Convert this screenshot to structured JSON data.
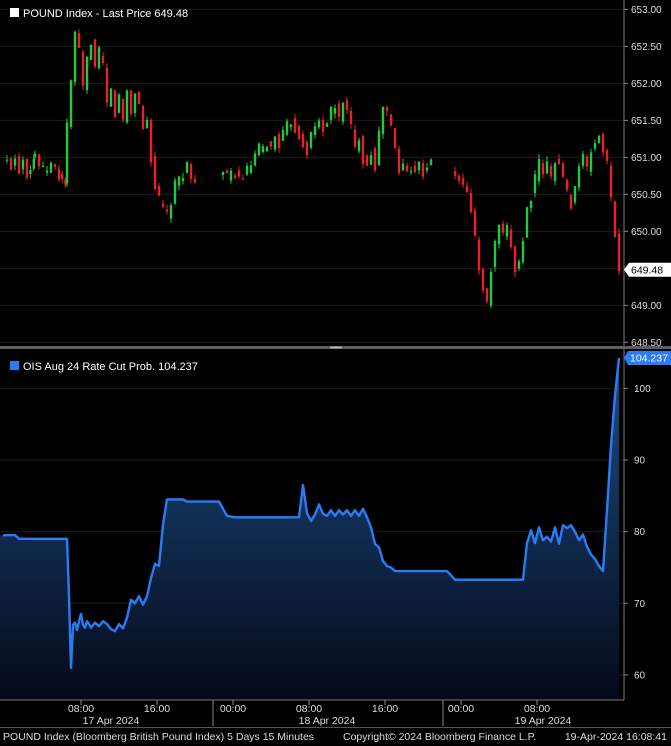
{
  "chart_data": [
    {
      "type": "candlestick",
      "legend": "POUND Index - Last Price 649.48",
      "last_value_label": "649.48",
      "ylim": [
        648.45,
        653.1
      ],
      "yticks": [
        648.5,
        649.0,
        649.5,
        650.0,
        650.5,
        651.0,
        651.5,
        652.0,
        652.5,
        653.0
      ],
      "ytick_labels": [
        "648.50",
        "649.00",
        "649.50",
        "650.00",
        "650.50",
        "651.00",
        "651.50",
        "652.00",
        "652.50",
        "653.00"
      ],
      "up_color": "#22c93a",
      "down_color": "#e8202a",
      "path": [
        [
          0,
          650.95
        ],
        [
          2,
          650.9
        ],
        [
          3,
          651.0
        ],
        [
          4,
          650.85
        ],
        [
          5,
          651.0
        ],
        [
          6,
          650.8
        ],
        [
          7.7,
          651.0
        ],
        [
          8,
          651.05
        ],
        [
          9,
          650.9
        ],
        [
          10,
          650.8
        ],
        [
          12,
          650.9
        ],
        [
          14,
          650.75
        ],
        [
          15.6,
          650.65
        ],
        [
          16,
          651.4
        ],
        [
          17,
          652.0
        ],
        [
          18,
          652.7
        ],
        [
          19,
          652.4
        ],
        [
          20,
          651.9
        ],
        [
          21,
          652.3
        ],
        [
          22,
          652.6
        ],
        [
          23,
          652.2
        ],
        [
          24,
          652.4
        ],
        [
          25,
          652.2
        ],
        [
          26,
          651.7
        ],
        [
          27,
          651.9
        ],
        [
          28,
          651.6
        ],
        [
          29,
          651.8
        ],
        [
          30,
          651.5
        ],
        [
          31,
          651.9
        ],
        [
          32,
          651.6
        ],
        [
          33,
          651.9
        ],
        [
          34,
          651.7
        ],
        [
          35,
          651.4
        ],
        [
          36,
          651.5
        ],
        [
          37,
          651.0
        ],
        [
          38,
          650.6
        ],
        [
          39,
          650.4
        ],
        [
          40,
          650.3
        ],
        [
          41,
          650.2
        ],
        [
          42,
          650.4
        ],
        [
          43,
          650.6
        ],
        [
          44,
          650.7
        ],
        [
          45,
          650.8
        ],
        [
          46,
          650.9
        ],
        [
          47,
          650.7
        ],
        [
          48,
          650.75
        ],
        [
          54,
          650.75
        ],
        [
          55,
          650.8
        ],
        [
          56,
          650.7
        ],
        [
          57,
          650.75
        ],
        [
          58,
          650.8
        ],
        [
          59,
          650.7
        ],
        [
          60,
          650.75
        ],
        [
          61,
          650.8
        ],
        [
          62,
          650.9
        ],
        [
          63,
          651.0
        ],
        [
          64,
          651.1
        ],
        [
          65,
          651.1
        ],
        [
          66,
          651.2
        ],
        [
          67,
          651.1
        ],
        [
          68,
          651.3
        ],
        [
          69,
          651.2
        ],
        [
          70,
          651.3
        ],
        [
          71,
          651.4
        ],
        [
          72,
          651.5
        ],
        [
          73,
          651.4
        ],
        [
          74,
          651.3
        ],
        [
          75,
          651.2
        ],
        [
          76,
          651.1
        ],
        [
          77,
          651.3
        ],
        [
          78,
          651.4
        ],
        [
          79,
          651.5
        ],
        [
          80,
          651.4
        ],
        [
          81,
          651.5
        ],
        [
          82,
          651.6
        ],
        [
          83,
          651.7
        ],
        [
          84,
          651.5
        ],
        [
          85,
          651.8
        ],
        [
          86,
          651.6
        ],
        [
          87,
          651.4
        ],
        [
          88,
          651.1
        ],
        [
          89,
          651.3
        ],
        [
          90,
          651.0
        ],
        [
          91,
          650.9
        ],
        [
          92,
          651.1
        ],
        [
          93,
          650.9
        ],
        [
          94,
          651.3
        ],
        [
          95,
          651.7
        ],
        [
          96,
          651.6
        ],
        [
          97,
          651.4
        ],
        [
          98,
          651.1
        ],
        [
          99,
          650.8
        ],
        [
          100,
          650.9
        ],
        [
          101,
          650.8
        ],
        [
          102,
          650.9
        ],
        [
          103,
          650.85
        ],
        [
          104,
          650.9
        ],
        [
          105,
          650.8
        ],
        [
          106,
          650.9
        ],
        [
          107,
          650.9
        ],
        [
          112,
          650.8
        ],
        [
          113,
          650.75
        ],
        [
          114,
          650.7
        ],
        [
          115,
          650.6
        ],
        [
          116,
          650.5
        ],
        [
          117,
          650.3
        ],
        [
          118,
          649.9
        ],
        [
          119,
          649.5
        ],
        [
          120,
          649.2
        ],
        [
          121,
          649.0
        ],
        [
          122,
          649.5
        ],
        [
          123,
          649.8
        ],
        [
          124,
          650.1
        ],
        [
          125,
          649.9
        ],
        [
          126,
          650.0
        ],
        [
          127,
          649.8
        ],
        [
          128,
          649.5
        ],
        [
          129,
          649.6
        ],
        [
          130,
          649.9
        ],
        [
          131,
          650.3
        ],
        [
          132,
          650.5
        ],
        [
          133,
          650.7
        ],
        [
          134,
          650.9
        ],
        [
          135,
          650.8
        ],
        [
          136,
          650.9
        ],
        [
          137,
          650.7
        ],
        [
          138,
          651.0
        ],
        [
          139,
          650.9
        ],
        [
          140,
          650.7
        ],
        [
          141,
          650.5
        ],
        [
          142,
          650.4
        ],
        [
          143,
          650.6
        ],
        [
          144,
          650.9
        ],
        [
          145,
          651.0
        ],
        [
          146,
          650.8
        ],
        [
          147,
          651.1
        ],
        [
          148,
          651.2
        ],
        [
          149,
          651.3
        ],
        [
          150,
          651.1
        ],
        [
          151,
          650.9
        ],
        [
          152,
          650.4
        ],
        [
          153,
          650.0
        ],
        [
          154,
          649.48
        ]
      ],
      "gaps": [
        48,
        107
      ]
    },
    {
      "type": "area",
      "legend": "OIS Aug 24 Rate Cut Prob. 104.237",
      "last_value_label": "104.237",
      "ylim": [
        56.5,
        105.5
      ],
      "yticks": [
        60,
        70,
        80,
        90,
        100
      ],
      "ytick_labels": [
        "60",
        "70",
        "80",
        "90",
        "100"
      ],
      "line_color": "#2a7cf6",
      "points": [
        [
          0,
          79.5
        ],
        [
          3,
          79.5
        ],
        [
          4,
          79.0
        ],
        [
          16,
          79.0
        ],
        [
          16.5,
          71.0
        ],
        [
          17,
          61.0
        ],
        [
          17.5,
          67.0
        ],
        [
          18,
          67.3
        ],
        [
          18.5,
          66.3
        ],
        [
          19,
          67.5
        ],
        [
          19.5,
          68.5
        ],
        [
          20,
          67.0
        ],
        [
          20.5,
          66.6
        ],
        [
          21,
          67.5
        ],
        [
          21.5,
          67.1
        ],
        [
          22,
          66.6
        ],
        [
          23,
          67.3
        ],
        [
          24,
          66.8
        ],
        [
          25,
          67.5
        ],
        [
          26,
          67.1
        ],
        [
          27,
          66.4
        ],
        [
          28,
          66.1
        ],
        [
          29,
          67.1
        ],
        [
          30,
          66.5
        ],
        [
          31,
          68.0
        ],
        [
          32,
          70.5
        ],
        [
          33,
          70.0
        ],
        [
          34,
          71.0
        ],
        [
          35,
          69.8
        ],
        [
          36,
          71.0
        ],
        [
          37,
          73.5
        ],
        [
          38,
          75.5
        ],
        [
          39,
          75.2
        ],
        [
          40,
          81.0
        ],
        [
          41,
          84.5
        ],
        [
          45,
          84.5
        ],
        [
          46,
          84.2
        ],
        [
          54,
          84.2
        ],
        [
          55,
          83.2
        ],
        [
          56,
          82.2
        ],
        [
          58,
          82.0
        ],
        [
          74,
          82.0
        ],
        [
          75,
          86.5
        ],
        [
          76,
          82.6
        ],
        [
          77,
          81.5
        ],
        [
          78,
          82.4
        ],
        [
          79,
          83.8
        ],
        [
          80,
          82.5
        ],
        [
          81,
          82.2
        ],
        [
          82,
          83.0
        ],
        [
          83,
          82.2
        ],
        [
          84,
          83.0
        ],
        [
          85,
          82.4
        ],
        [
          86,
          83.0
        ],
        [
          87,
          82.2
        ],
        [
          88,
          83.0
        ],
        [
          89,
          82.2
        ],
        [
          90,
          83.2
        ],
        [
          91,
          82.0
        ],
        [
          92,
          80.6
        ],
        [
          93,
          78.3
        ],
        [
          94,
          77.8
        ],
        [
          95,
          75.9
        ],
        [
          96,
          75.2
        ],
        [
          97,
          75.0
        ],
        [
          98,
          74.5
        ],
        [
          111,
          74.5
        ],
        [
          113,
          73.3
        ],
        [
          125,
          73.3
        ],
        [
          130,
          73.3
        ],
        [
          131,
          78.4
        ],
        [
          132,
          80.2
        ],
        [
          133,
          78.4
        ],
        [
          134,
          80.6
        ],
        [
          135,
          78.8
        ],
        [
          136,
          79.3
        ],
        [
          137,
          78.6
        ],
        [
          138,
          80.6
        ],
        [
          139,
          78.3
        ],
        [
          140,
          80.9
        ],
        [
          141,
          80.5
        ],
        [
          142,
          80.9
        ],
        [
          143,
          80.0
        ],
        [
          144,
          78.8
        ],
        [
          145,
          79.6
        ],
        [
          146,
          77.9
        ],
        [
          147,
          76.8
        ],
        [
          148,
          76.2
        ],
        [
          149,
          75.2
        ],
        [
          150,
          74.5
        ],
        [
          151,
          83.0
        ],
        [
          152,
          92.0
        ],
        [
          153,
          99.0
        ],
        [
          154,
          104.237
        ]
      ]
    }
  ],
  "x_axis": {
    "time_labels": [
      {
        "t": 19.5,
        "text": "08:00"
      },
      {
        "t": 38.5,
        "text": "16:00"
      },
      {
        "t": 57.5,
        "text": "00:00"
      },
      {
        "t": 76.5,
        "text": "08:00"
      },
      {
        "t": 95.5,
        "text": "16:00"
      },
      {
        "t": 114.5,
        "text": "00:00"
      },
      {
        "t": 133.5,
        "text": "08:00"
      }
    ],
    "date_labels": [
      {
        "t": 27,
        "text": "17 Apr 2024"
      },
      {
        "t": 81,
        "text": "18 Apr 2024"
      },
      {
        "t": 135,
        "text": "19 Apr 2024"
      }
    ],
    "day_separators": [
      52.5,
      110.0
    ]
  },
  "footer": {
    "left": "POUND Index (Bloomberg British Pound Index) 5 Days 15 Minutes",
    "center": "Copyright© 2024 Bloomberg Finance L.P.",
    "right": "19-Apr-2024 16:08:41"
  }
}
